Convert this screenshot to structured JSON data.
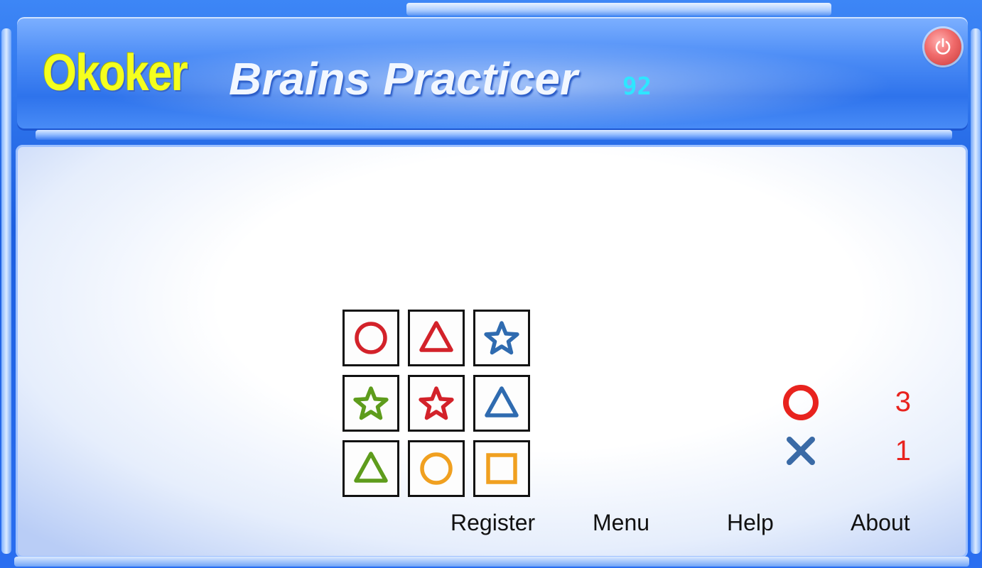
{
  "header": {
    "brand": "Okoker",
    "title": "Brains Practicer",
    "score": "92"
  },
  "grid": {
    "cells": [
      {
        "shape": "circle",
        "color": "#d3222a"
      },
      {
        "shape": "triangle",
        "color": "#d3222a"
      },
      {
        "shape": "star",
        "color": "#2f6bb0"
      },
      {
        "shape": "star",
        "color": "#5e9c1c"
      },
      {
        "shape": "star",
        "color": "#d3222a"
      },
      {
        "shape": "triangle",
        "color": "#2f6bb0"
      },
      {
        "shape": "triangle",
        "color": "#5e9c1c"
      },
      {
        "shape": "circle",
        "color": "#f0a020"
      },
      {
        "shape": "square",
        "color": "#f0a020"
      }
    ]
  },
  "results": {
    "correct_count": "3",
    "wrong_count": "1",
    "correct_icon": "circle-icon",
    "wrong_icon": "cross-icon"
  },
  "menu": {
    "register": "Register",
    "menu": "Menu",
    "help": "Help",
    "about": "About"
  },
  "colors": {
    "accent_blue": "#2e73ec",
    "brand_yellow": "#f4ff1e",
    "score_cyan": "#2ee6ff",
    "count_red": "#e8231e"
  }
}
